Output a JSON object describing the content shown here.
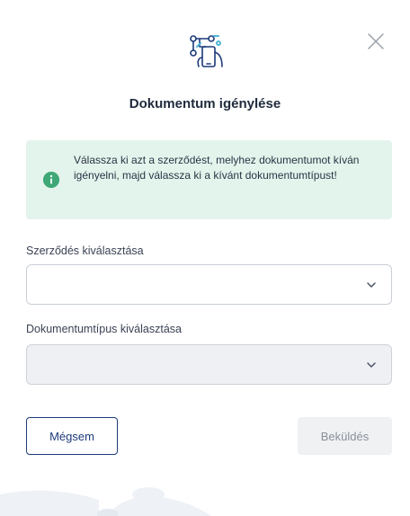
{
  "modal": {
    "title": "Dokumentum igénylése",
    "header_icon": "document-request-icon",
    "close_icon": "close-icon"
  },
  "info": {
    "icon": "info-icon",
    "text": "Válassza ki azt a szerződést, melyhez dokumentumot kíván igényelni, majd válassza ki a kívánt dokumentumtípust!"
  },
  "fields": {
    "contract_label": "Szerződés kiválasztása",
    "contract_value": "",
    "doctype_label": "Dokumentumtípus kiválasztása",
    "doctype_value": ""
  },
  "buttons": {
    "cancel": "Mégsem",
    "submit": "Beküldés"
  },
  "colors": {
    "accent": "#1c3a7a",
    "info_bg": "#e3f4ec",
    "info_icon": "#3ea876"
  }
}
